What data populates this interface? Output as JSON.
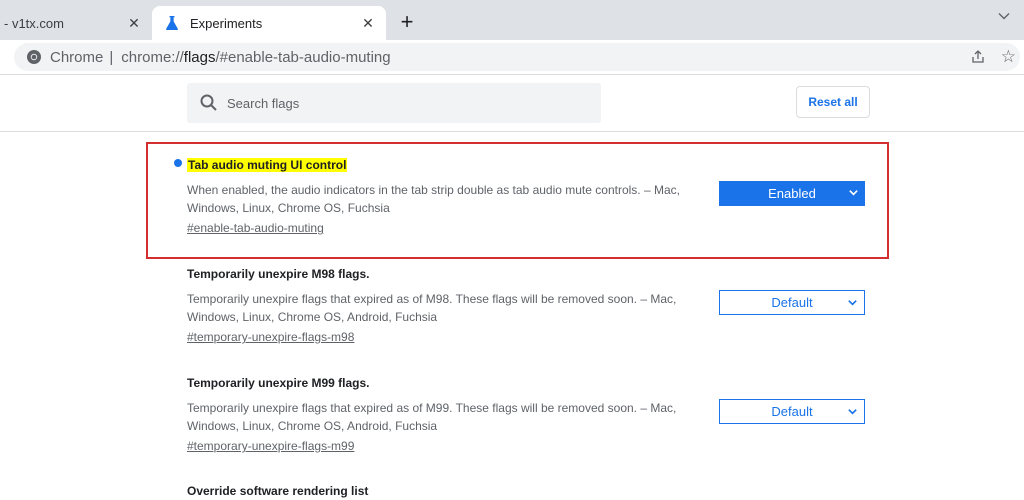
{
  "tabs": [
    {
      "title": "- v1tx.com",
      "active": false
    },
    {
      "title": "Experiments",
      "active": true
    }
  ],
  "omnibox": {
    "scheme_label": "Chrome",
    "separator": "|",
    "url_prefix": "chrome://",
    "url_host": "flags",
    "url_suffix": "/#enable-tab-audio-muting"
  },
  "header": {
    "search_placeholder": "Search flags",
    "reset_label": "Reset all"
  },
  "experiments": [
    {
      "title": "Tab audio muting UI control",
      "description": "When enabled, the audio indicators in the tab strip double as tab audio mute controls. – Mac, Windows, Linux, Chrome OS, Fuchsia",
      "link": "#enable-tab-audio-muting",
      "value": "Enabled",
      "modified": true,
      "highlighted": true
    },
    {
      "title": "Temporarily unexpire M98 flags.",
      "description": "Temporarily unexpire flags that expired as of M98. These flags will be removed soon. – Mac, Windows, Linux, Chrome OS, Android, Fuchsia",
      "link": "#temporary-unexpire-flags-m98",
      "value": "Default"
    },
    {
      "title": "Temporarily unexpire M99 flags.",
      "description": "Temporarily unexpire flags that expired as of M99. These flags will be removed soon. – Mac, Windows, Linux, Chrome OS, Android, Fuchsia",
      "link": "#temporary-unexpire-flags-m99",
      "value": "Default"
    },
    {
      "title": "Override software rendering list"
    }
  ],
  "colors": {
    "accent": "#1a73e8",
    "highlight": "#ffff00",
    "annotation_box": "#d32f2f",
    "modified_dot": "#1a73e8"
  }
}
